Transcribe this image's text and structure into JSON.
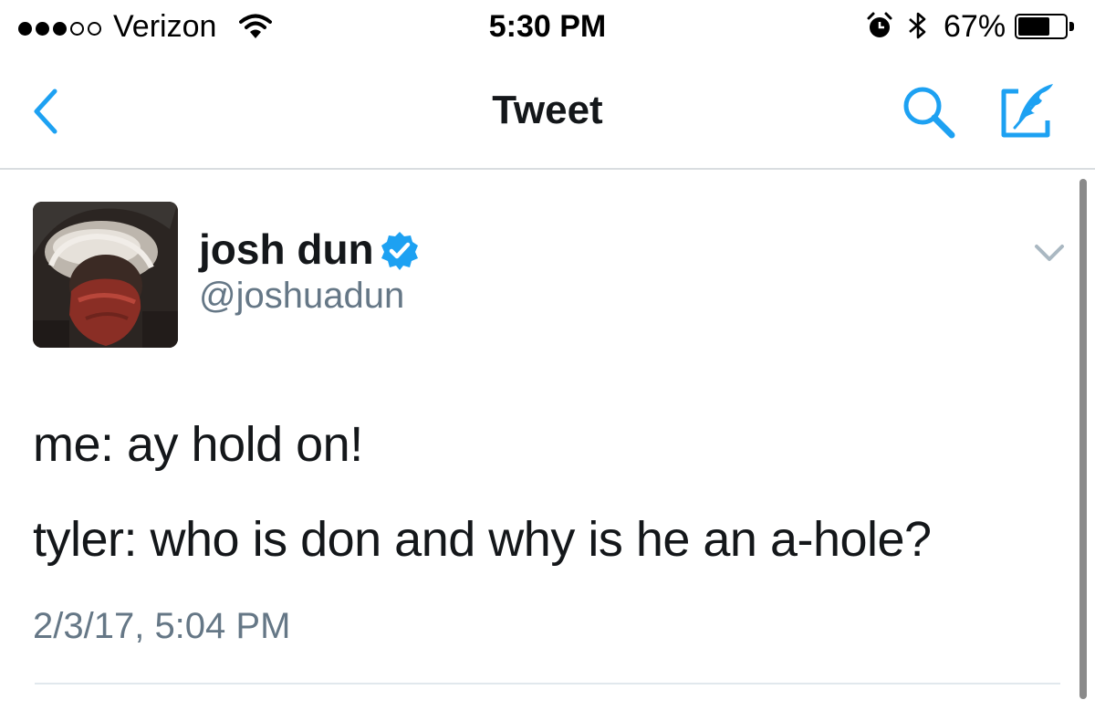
{
  "status_bar": {
    "carrier": "Verizon",
    "time": "5:30 PM",
    "battery_percent": "67%",
    "battery_level": 0.67,
    "signal_bars_filled": 3,
    "signal_bars_total": 5,
    "icons": [
      "wifi-icon",
      "alarm-icon",
      "bluetooth-icon",
      "battery-icon"
    ]
  },
  "nav": {
    "title": "Tweet",
    "accent_color": "#1da1f2",
    "icons": [
      "back-chevron-icon",
      "search-icon",
      "compose-icon"
    ]
  },
  "tweet": {
    "author_name": "josh dun",
    "author_handle": "@joshuadun",
    "verified": true,
    "lines": [
      "me: ay hold on!",
      "tyler: who is don and why is he an a-hole?"
    ],
    "timestamp": "2/3/17, 5:04 PM",
    "icons": [
      "verified-badge-icon",
      "chevron-down-icon"
    ]
  }
}
